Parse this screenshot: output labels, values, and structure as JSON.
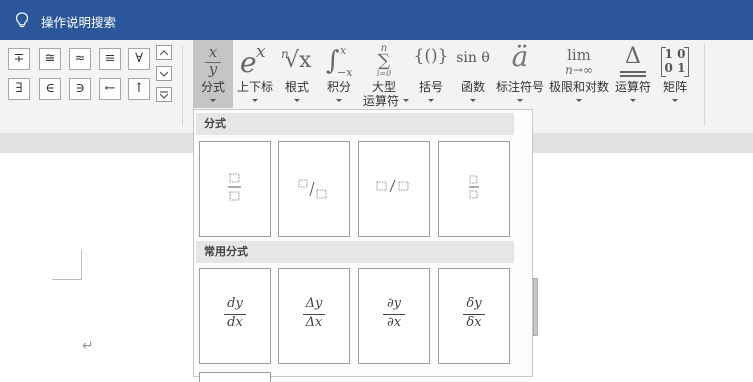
{
  "titlebar": {
    "search_label": "操作说明搜索"
  },
  "symbols": {
    "row1": [
      "∓",
      "≅",
      "≈",
      "≡",
      "∀"
    ],
    "row2": [
      "∃",
      "∈",
      "∋",
      "←",
      "↑"
    ]
  },
  "ribbon": {
    "fraction": {
      "icon_top": "x",
      "icon_bottom": "y",
      "label": "分式"
    },
    "script": {
      "icon_base": "e",
      "icon_sup": "x",
      "label": "上下标"
    },
    "radical": {
      "icon_index": "n",
      "icon_body": "√x",
      "label": "根式"
    },
    "integral": {
      "icon": "∫",
      "icon_sup": "x",
      "icon_sub": "−x",
      "label": "积分"
    },
    "large_operator": {
      "icon_top": "n",
      "icon": "∑",
      "icon_sub": "i=0",
      "label_line1": "大型",
      "label_line2": "运算符"
    },
    "bracket": {
      "icon": "{()}",
      "label": "括号"
    },
    "function": {
      "icon": "sin θ",
      "label": "函数"
    },
    "accent": {
      "icon": "ä",
      "label": "标注符号"
    },
    "limit": {
      "icon_top": "lim",
      "icon_bottom": "n→∞",
      "label": "极限和对数"
    },
    "operator": {
      "icon": "Δ",
      "label": "运算符"
    },
    "matrix": {
      "icon_row1": "1 0",
      "icon_row2": "0 1",
      "label": "矩阵"
    }
  },
  "gallery": {
    "section1_title": "分式",
    "section2_title": "常用分式",
    "common": [
      {
        "num": "dy",
        "den": "dx"
      },
      {
        "num": "Δy",
        "den": "Δx"
      },
      {
        "num": "∂y",
        "den": "∂x"
      },
      {
        "num": "δy",
        "den": "δx"
      }
    ]
  },
  "document": {
    "paragraph_mark": "↵"
  }
}
